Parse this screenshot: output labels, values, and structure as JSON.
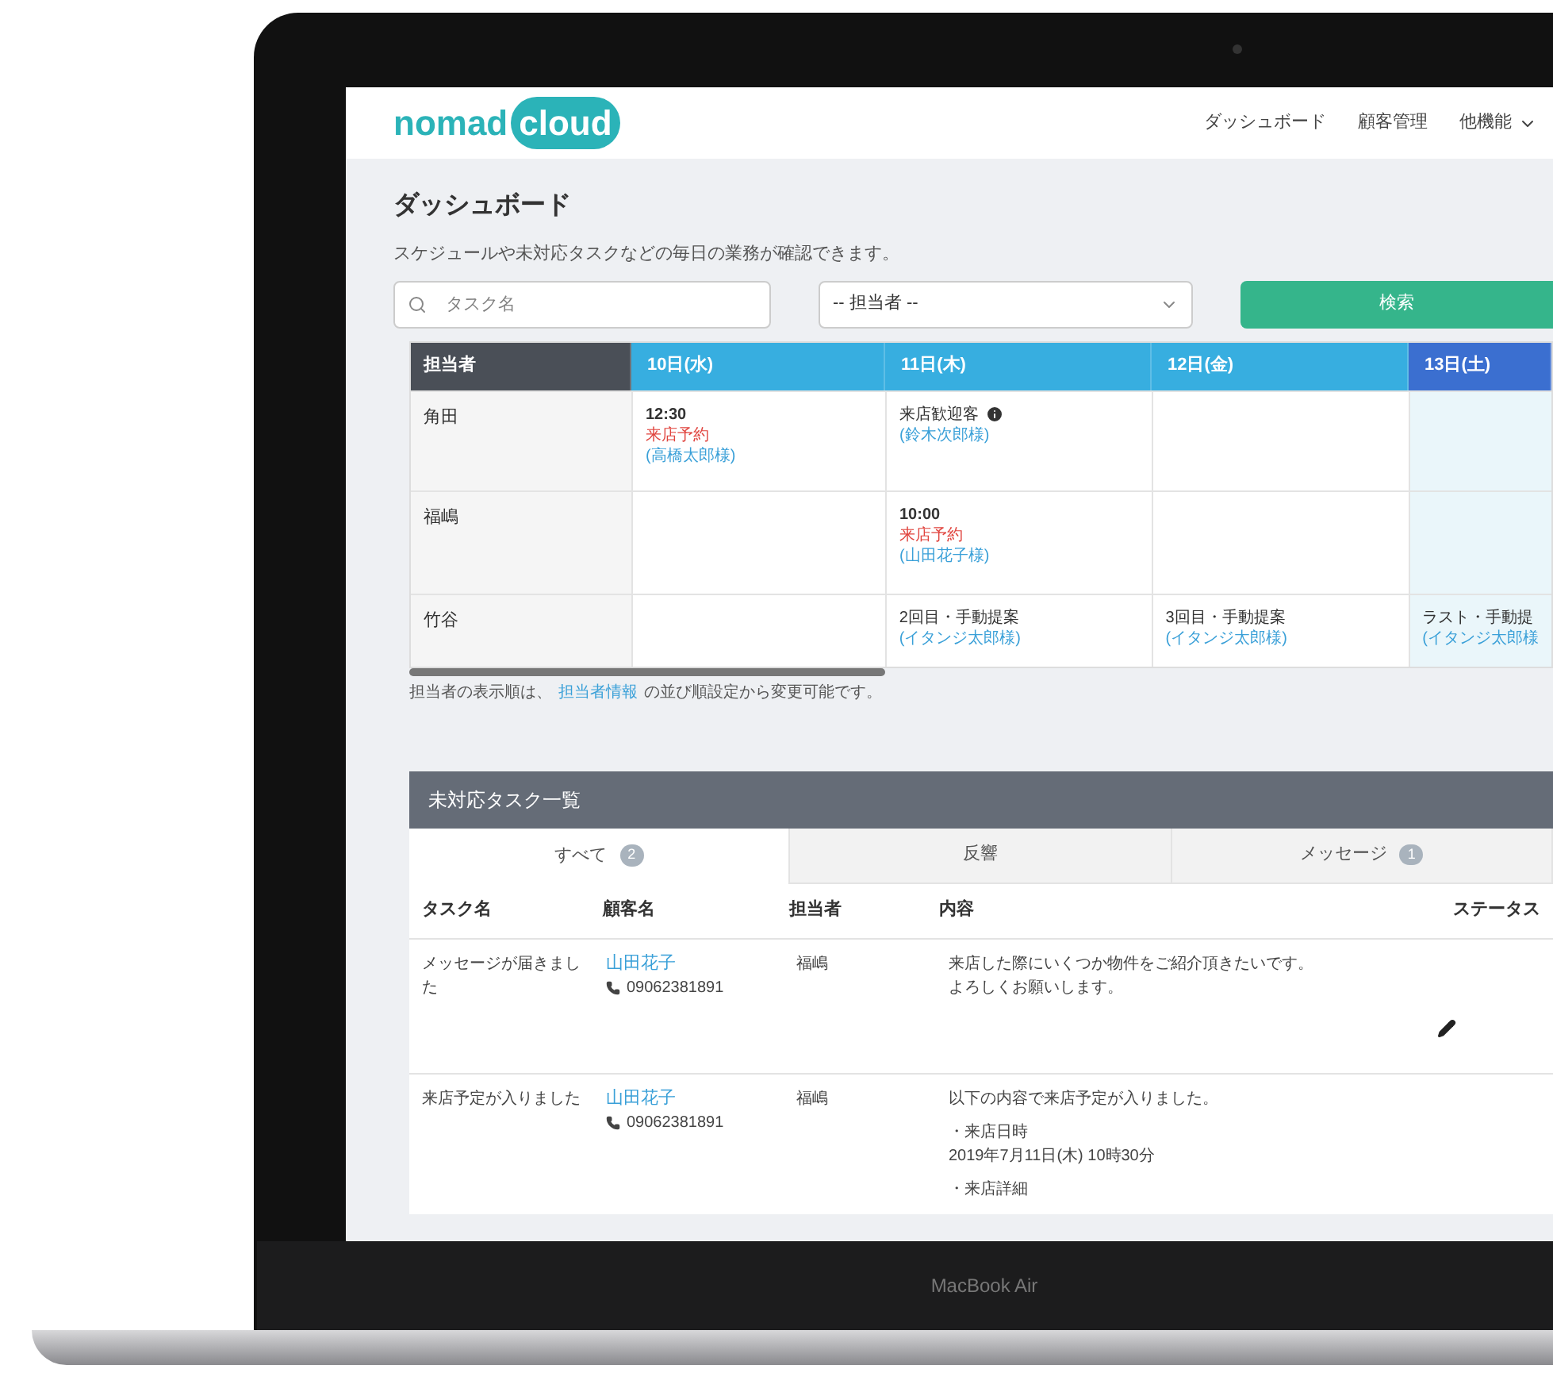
{
  "header": {
    "logo": {
      "part_1": "nomad",
      "part_2": "cloud"
    },
    "nav": [
      {
        "label": "ダッシュボード",
        "dropdown": false
      },
      {
        "label": "顧客管理",
        "dropdown": false
      },
      {
        "label": "他機能",
        "dropdown": true
      }
    ]
  },
  "page": {
    "title": "ダッシュボード",
    "description": "スケジュールや未対応タスクなどの毎日の業務が確認できます。"
  },
  "filters": {
    "search": {
      "placeholder": "タスク名"
    },
    "assignee_select": {
      "value": "-- 担当者 --"
    },
    "search_button": "検索"
  },
  "schedule": {
    "columns": [
      {
        "label": "担当者",
        "kind": "name",
        "highlight": false
      },
      {
        "label": "10日(水)",
        "kind": "date",
        "highlight": false
      },
      {
        "label": "11日(木)",
        "kind": "date",
        "highlight": false
      },
      {
        "label": "12日(金)",
        "kind": "date",
        "highlight": false
      },
      {
        "label": "13日(土)",
        "kind": "date",
        "highlight": true
      }
    ],
    "rows": [
      {
        "cells": [
          "角田",
          [
            {
              "kind": "time",
              "text": "12:30"
            },
            {
              "kind": "event",
              "text": "来店予約"
            },
            {
              "kind": "customer",
              "text": "(高橋太郎様)"
            }
          ],
          [
            {
              "kind": "title",
              "text": "来店歓迎客",
              "info": true
            },
            {
              "kind": "customer",
              "text": "(鈴木次郎様)"
            }
          ],
          "",
          ""
        ]
      },
      {
        "cells": [
          "福嶋",
          "",
          [
            {
              "kind": "time",
              "text": "10:00"
            },
            {
              "kind": "event",
              "text": "来店予約"
            },
            {
              "kind": "customer",
              "text": "(山田花子様)"
            }
          ],
          "",
          ""
        ]
      },
      {
        "cells": [
          "竹谷",
          "",
          [
            {
              "kind": "title",
              "text": "2回目・手動提案",
              "info": false
            },
            {
              "kind": "customer",
              "text": "(イタンジ太郎様)"
            }
          ],
          [
            {
              "kind": "title",
              "text": "3回目・手動提案",
              "info": false
            },
            {
              "kind": "customer",
              "text": "(イタンジ太郎様)"
            }
          ],
          [
            {
              "kind": "title",
              "text": "ラスト・手動提",
              "info": false
            },
            {
              "kind": "customer",
              "text": "(イタンジ太郎様"
            }
          ]
        ]
      }
    ],
    "note": {
      "before": "担当者の表示順は、",
      "link": "担当者情報",
      "after": "の並び順設定から変更可能です。"
    }
  },
  "tasks": {
    "title": "未対応タスク一覧",
    "tabs": [
      {
        "label": "すべて",
        "badge": "2",
        "selected": true
      },
      {
        "label": "反響",
        "selected": false
      },
      {
        "label": "メッセージ",
        "badge": "1",
        "selected": false
      }
    ],
    "columns": [
      "タスク名",
      "顧客名",
      "担当者",
      "内容",
      "ステータス"
    ],
    "rows": [
      {
        "task": "メッセージが届きました",
        "customer": "山田花子",
        "phone": "09062381891",
        "assignee": "福嶋",
        "content": [
          {
            "kind": "text",
            "text": "来店した際にいくつか物件をご紹介頂きたいです。"
          },
          {
            "kind": "text",
            "text": "よろしくお願いします。"
          }
        ],
        "editable": true
      },
      {
        "task": "来店予定が入りました",
        "customer": "山田花子",
        "phone": "09062381891",
        "assignee": "福嶋",
        "content": [
          {
            "kind": "text",
            "text": "以下の内容で来店予定が入りました。"
          },
          {
            "kind": "heading",
            "text": "・来店日時"
          },
          {
            "kind": "text",
            "text": "2019年7月11日(木) 10時30分"
          },
          {
            "kind": "heading",
            "text": "・来店詳細"
          }
        ],
        "editable": false
      }
    ]
  },
  "device": {
    "label": "MacBook Air"
  }
}
